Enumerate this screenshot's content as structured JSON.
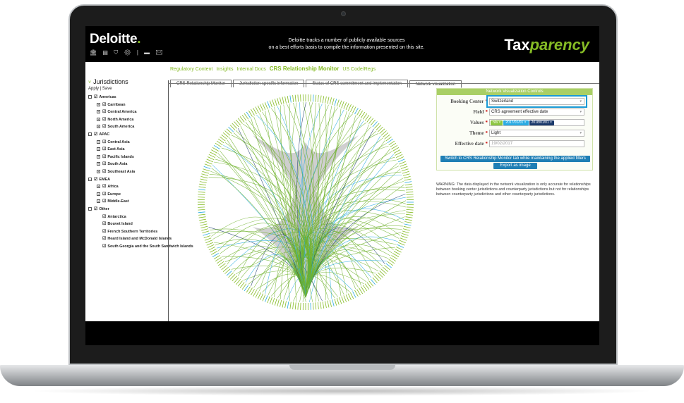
{
  "header": {
    "logo_text": "Deloitte",
    "logo_dot": ".",
    "icons": [
      "bank-icon",
      "document-icon",
      "shield-icon",
      "gear-icon",
      "card-icon",
      "mail-icon"
    ],
    "tagline_line1": "Deloitte tracks a number of publicly available sources",
    "tagline_line2": "on a best efforts basis to compile the information presented on this site.",
    "brand_a": "Tax",
    "brand_b": "parency"
  },
  "sidebar": {
    "title": "Jurisdictions",
    "apply": "Apply",
    "sep": " | ",
    "save": "Save",
    "tree": [
      {
        "level": 0,
        "label": "Americas",
        "box": "−"
      },
      {
        "level": 1,
        "label": "Carribean",
        "box": "+"
      },
      {
        "level": 1,
        "label": "Central America",
        "box": "+"
      },
      {
        "level": 1,
        "label": "North America",
        "box": "+"
      },
      {
        "level": 1,
        "label": "South America",
        "box": "+"
      },
      {
        "level": 0,
        "label": "APAC",
        "box": "−"
      },
      {
        "level": 1,
        "label": "Central Asia",
        "box": "+"
      },
      {
        "level": 1,
        "label": "East Asia",
        "box": "+"
      },
      {
        "level": 1,
        "label": "Pacific Islands",
        "box": "+"
      },
      {
        "level": 1,
        "label": "South Asia",
        "box": "+"
      },
      {
        "level": 1,
        "label": "Southeast Asia",
        "box": "+"
      },
      {
        "level": 0,
        "label": "EMEA",
        "box": "−"
      },
      {
        "level": 1,
        "label": "Africa",
        "box": "+"
      },
      {
        "level": 1,
        "label": "Europe",
        "box": "+"
      },
      {
        "level": 1,
        "label": "Middle-East",
        "box": "+"
      },
      {
        "level": 0,
        "label": "Other",
        "box": "−"
      },
      {
        "level": 2,
        "label": "Antarctica",
        "box": ""
      },
      {
        "level": 2,
        "label": "Bouvet Island",
        "box": ""
      },
      {
        "level": 2,
        "label": "French Southern Territories",
        "box": ""
      },
      {
        "level": 2,
        "label": "Heard Island and McDonald Islands",
        "box": ""
      },
      {
        "level": 2,
        "label": "South Georgia and the South Sandwich Islands",
        "box": ""
      }
    ]
  },
  "nav": {
    "items": [
      "Regulatory Content",
      "Insights",
      "Internal Docs",
      "CRS Relationship Monitor",
      "US Code/Regs"
    ],
    "active_index": 3
  },
  "tabs": {
    "items": [
      "CRS Relationship Monitor",
      "Jurisdiction-specific information",
      "Status of CRS commitment and implementation",
      "Network visualization"
    ],
    "active_index": 3
  },
  "controls": {
    "title": "Network Visualization Controls",
    "booking_center_label": "Booking Center",
    "booking_center_value": "Switzerland",
    "field_label": "Field",
    "field_value": "CRS agreement effective date",
    "values_label": "Values",
    "values_tags": [
      {
        "text": "n/a",
        "color": "#8cc63f"
      },
      {
        "text": "2017/01/01",
        "color": "#29abe2"
      },
      {
        "text": "2018/01/01",
        "color": "#1b3a6b"
      }
    ],
    "theme_label": "Theme",
    "theme_value": "Light",
    "effective_date_label": "Effective date",
    "effective_date_value": "19/02/2017",
    "switch_button": "Switch to CRS Relationship Monitor tab while maintaining the applied filters",
    "export_button": "Export as image",
    "required_mark": "*"
  },
  "warning": "WARNING: The data displayed in the network visualization is only accurate for relationships between booking center jurisdictions and counterparty jurisdictions but not for relationships between counterparty jurisdictions and other counterparty jurisdictions.",
  "colors": {
    "accent_green": "#86bc25",
    "light_blue": "#29abe2",
    "dark_navy": "#1b3a6b",
    "button_blue": "#1f7fb5",
    "highlight_blue": "#1a9ad6"
  }
}
